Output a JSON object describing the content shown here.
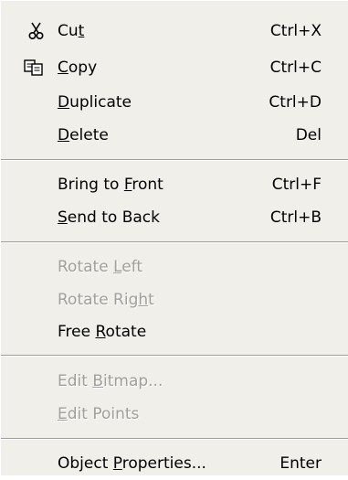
{
  "menu": {
    "items": [
      {
        "label_before": "Cu",
        "mnemonic": "t",
        "label_after": "",
        "shortcut": "Ctrl+X",
        "icon": "scissors-icon",
        "enabled": true
      },
      {
        "label_before": "",
        "mnemonic": "C",
        "label_after": "opy",
        "shortcut": "Ctrl+C",
        "icon": "copy-icon",
        "enabled": true
      },
      {
        "label_before": "",
        "mnemonic": "D",
        "label_after": "uplicate",
        "shortcut": "Ctrl+D",
        "enabled": true
      },
      {
        "label_before": "",
        "mnemonic": "D",
        "label_after": "elete",
        "shortcut": "Del",
        "enabled": true
      },
      {
        "label_before": "Bring to ",
        "mnemonic": "F",
        "label_after": "ront",
        "shortcut": "Ctrl+F",
        "enabled": true
      },
      {
        "label_before": "",
        "mnemonic": "S",
        "label_after": "end to Back",
        "shortcut": "Ctrl+B",
        "enabled": true
      },
      {
        "label_before": "Rotate ",
        "mnemonic": "L",
        "label_after": "eft",
        "shortcut": "",
        "enabled": false
      },
      {
        "label_before": "Rotate Rig",
        "mnemonic": "h",
        "label_after": "t",
        "shortcut": "",
        "enabled": false
      },
      {
        "label_before": "Free ",
        "mnemonic": "R",
        "label_after": "otate",
        "shortcut": "",
        "enabled": true
      },
      {
        "label_before": "Edit ",
        "mnemonic": "B",
        "label_after": "itmap...",
        "shortcut": "",
        "enabled": false
      },
      {
        "label_before": "",
        "mnemonic": "E",
        "label_after": "dit Points",
        "shortcut": "",
        "enabled": false
      },
      {
        "label_before": "Object ",
        "mnemonic": "P",
        "label_after": "roperties...",
        "shortcut": "Enter",
        "enabled": true
      }
    ]
  }
}
